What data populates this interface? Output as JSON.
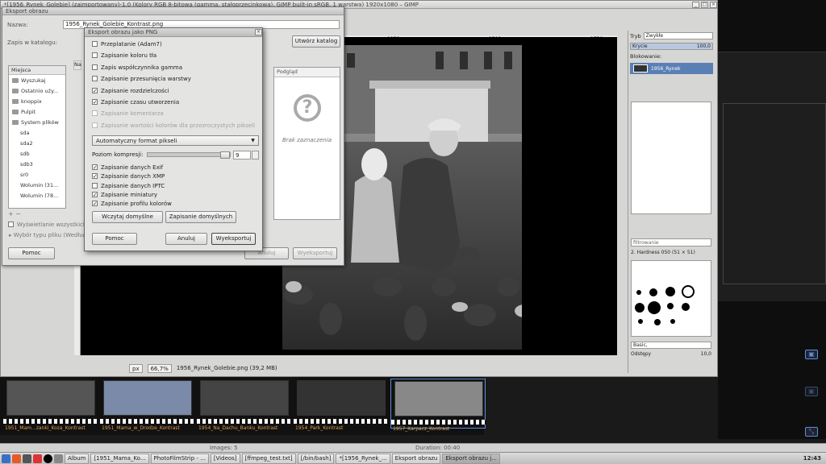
{
  "gimp": {
    "title": "*[1956_Rynek_Golebie] (zaimportowany)-1.0 (Kolory RGB 8-bitowa (gamma, stałoprzecinkowa), GIMP built-in sRGB, 1 warstwa) 1920x1080 – GIMP",
    "ruler_ticks": [
      "1250",
      "1500",
      "1750"
    ],
    "status": {
      "unit": "px",
      "zoom": "66,7%",
      "file_info": "1956_Rynek_Golebie.png (39,2 MB)"
    }
  },
  "layers_dock": {
    "mode_label": "Tryb",
    "mode_value": "Zwykłe",
    "opacity_label": "Krycie",
    "opacity_value": "100,0",
    "lock_label": "Blokowanie:",
    "layer_name": "1956_Rynek",
    "filter_placeholder": "filtrowanie",
    "brush_name": "2. Hardness 050 (51 × 51)",
    "brush_tag": "Basic,",
    "spacing_label": "Odstępy",
    "spacing_value": "10,0"
  },
  "export_dialog": {
    "title": "Eksport obrazu",
    "name_label": "Nazwa:",
    "name_value": "1956_Rynek_Golebie_Kontrast.png",
    "save_in_label": "Zapis w katalogu:",
    "create_folder": "Utwórz katalog",
    "places_header": "Miejsca",
    "name_col_header": "Na",
    "places": [
      {
        "label": "Wyszukaj",
        "sub": false
      },
      {
        "label": "Ostatnio uży...",
        "sub": false
      },
      {
        "label": "knoppix",
        "sub": false
      },
      {
        "label": "Pulpit",
        "sub": false
      },
      {
        "label": "System plików",
        "sub": false
      },
      {
        "label": "sda",
        "sub": true
      },
      {
        "label": "sda2",
        "sub": true
      },
      {
        "label": "sdb",
        "sub": true
      },
      {
        "label": "sdb3",
        "sub": true
      },
      {
        "label": "sr0",
        "sub": true
      },
      {
        "label": "Wolumin (31...",
        "sub": true
      },
      {
        "label": "Wolumin (78...",
        "sub": true
      }
    ],
    "preview_header": "Podgląd",
    "no_selection": "Brak zaznaczenia",
    "show_all": "Wyświetlanie wszystkich",
    "file_type": "Wybór typu pliku (Według",
    "help": "Pomoc",
    "cancel": "Anuluj",
    "export": "Wyeksportuj"
  },
  "png_dialog": {
    "title": "Eksport obrazu jako PNG",
    "options": [
      {
        "label": "Przeplatanie (Adam7)",
        "checked": false,
        "disabled": false
      },
      {
        "label": "Zapisanie koloru tła",
        "checked": false,
        "disabled": false
      },
      {
        "label": "Zapis współczynnika gamma",
        "checked": false,
        "disabled": false
      },
      {
        "label": "Zapisanie przesunięcia warstwy",
        "checked": false,
        "disabled": false
      },
      {
        "label": "Zapisanie rozdzielczości",
        "checked": true,
        "disabled": false
      },
      {
        "label": "Zapisanie czasu utworzenia",
        "checked": true,
        "disabled": false
      },
      {
        "label": "Zapisanie komentarza",
        "checked": false,
        "disabled": true
      },
      {
        "label": "Zapisanie wartości kolorów dla przezroczystych pikseli",
        "checked": false,
        "disabled": true
      }
    ],
    "pixel_format": "Automatyczny format pikseli",
    "compression_label": "Poziom kompresji:",
    "compression_value": "9",
    "compression_level": 9,
    "compression_max": 9,
    "meta_options": [
      {
        "label": "Zapisanie danych Exif",
        "checked": true
      },
      {
        "label": "Zapisanie danych XMP",
        "checked": true
      },
      {
        "label": "Zapisanie danych IPTC",
        "checked": false
      },
      {
        "label": "Zapisanie miniatury",
        "checked": true
      },
      {
        "label": "Zapisanie profilu kolorów",
        "checked": true
      }
    ],
    "load_defaults": "Wczytaj domyślne",
    "save_defaults": "Zapisanie domyślnych",
    "help": "Pomoc",
    "cancel": "Anuluj",
    "export": "Wyeksportuj"
  },
  "filmstrip": {
    "frames": [
      {
        "label": "1951_Mam...zanki_Koza_Kontrast"
      },
      {
        "label": "1951_Mama_w_Drodze_Kontrast"
      },
      {
        "label": "1954_Na_Dachu_Banku_Kontrast"
      },
      {
        "label": "1954_Park_Kontrast"
      },
      {
        "label": "1957_Karpacz_Kontrast"
      }
    ],
    "images_count": "Images: 5",
    "duration": "Duration: 00:40"
  },
  "taskbar": {
    "tasks": [
      {
        "label": "Album",
        "active": false
      },
      {
        "label": "[1951_Mama_Ko...",
        "active": false
      },
      {
        "label": "PhotoFilmStrip - ...",
        "active": false
      },
      {
        "label": "[Videos]",
        "active": false
      },
      {
        "label": "[ffmpeg_test.txt]",
        "active": false
      },
      {
        "label": "[/bin/bash]",
        "active": false
      },
      {
        "label": "*[1956_Rynek_...",
        "active": false
      },
      {
        "label": "Eksport obrazu",
        "active": false
      },
      {
        "label": "Eksport obrazu j...",
        "active": true
      }
    ],
    "clock": "12:43"
  },
  "colors": {
    "accent": "#5a7fb4",
    "film_label": "#e0a050"
  }
}
